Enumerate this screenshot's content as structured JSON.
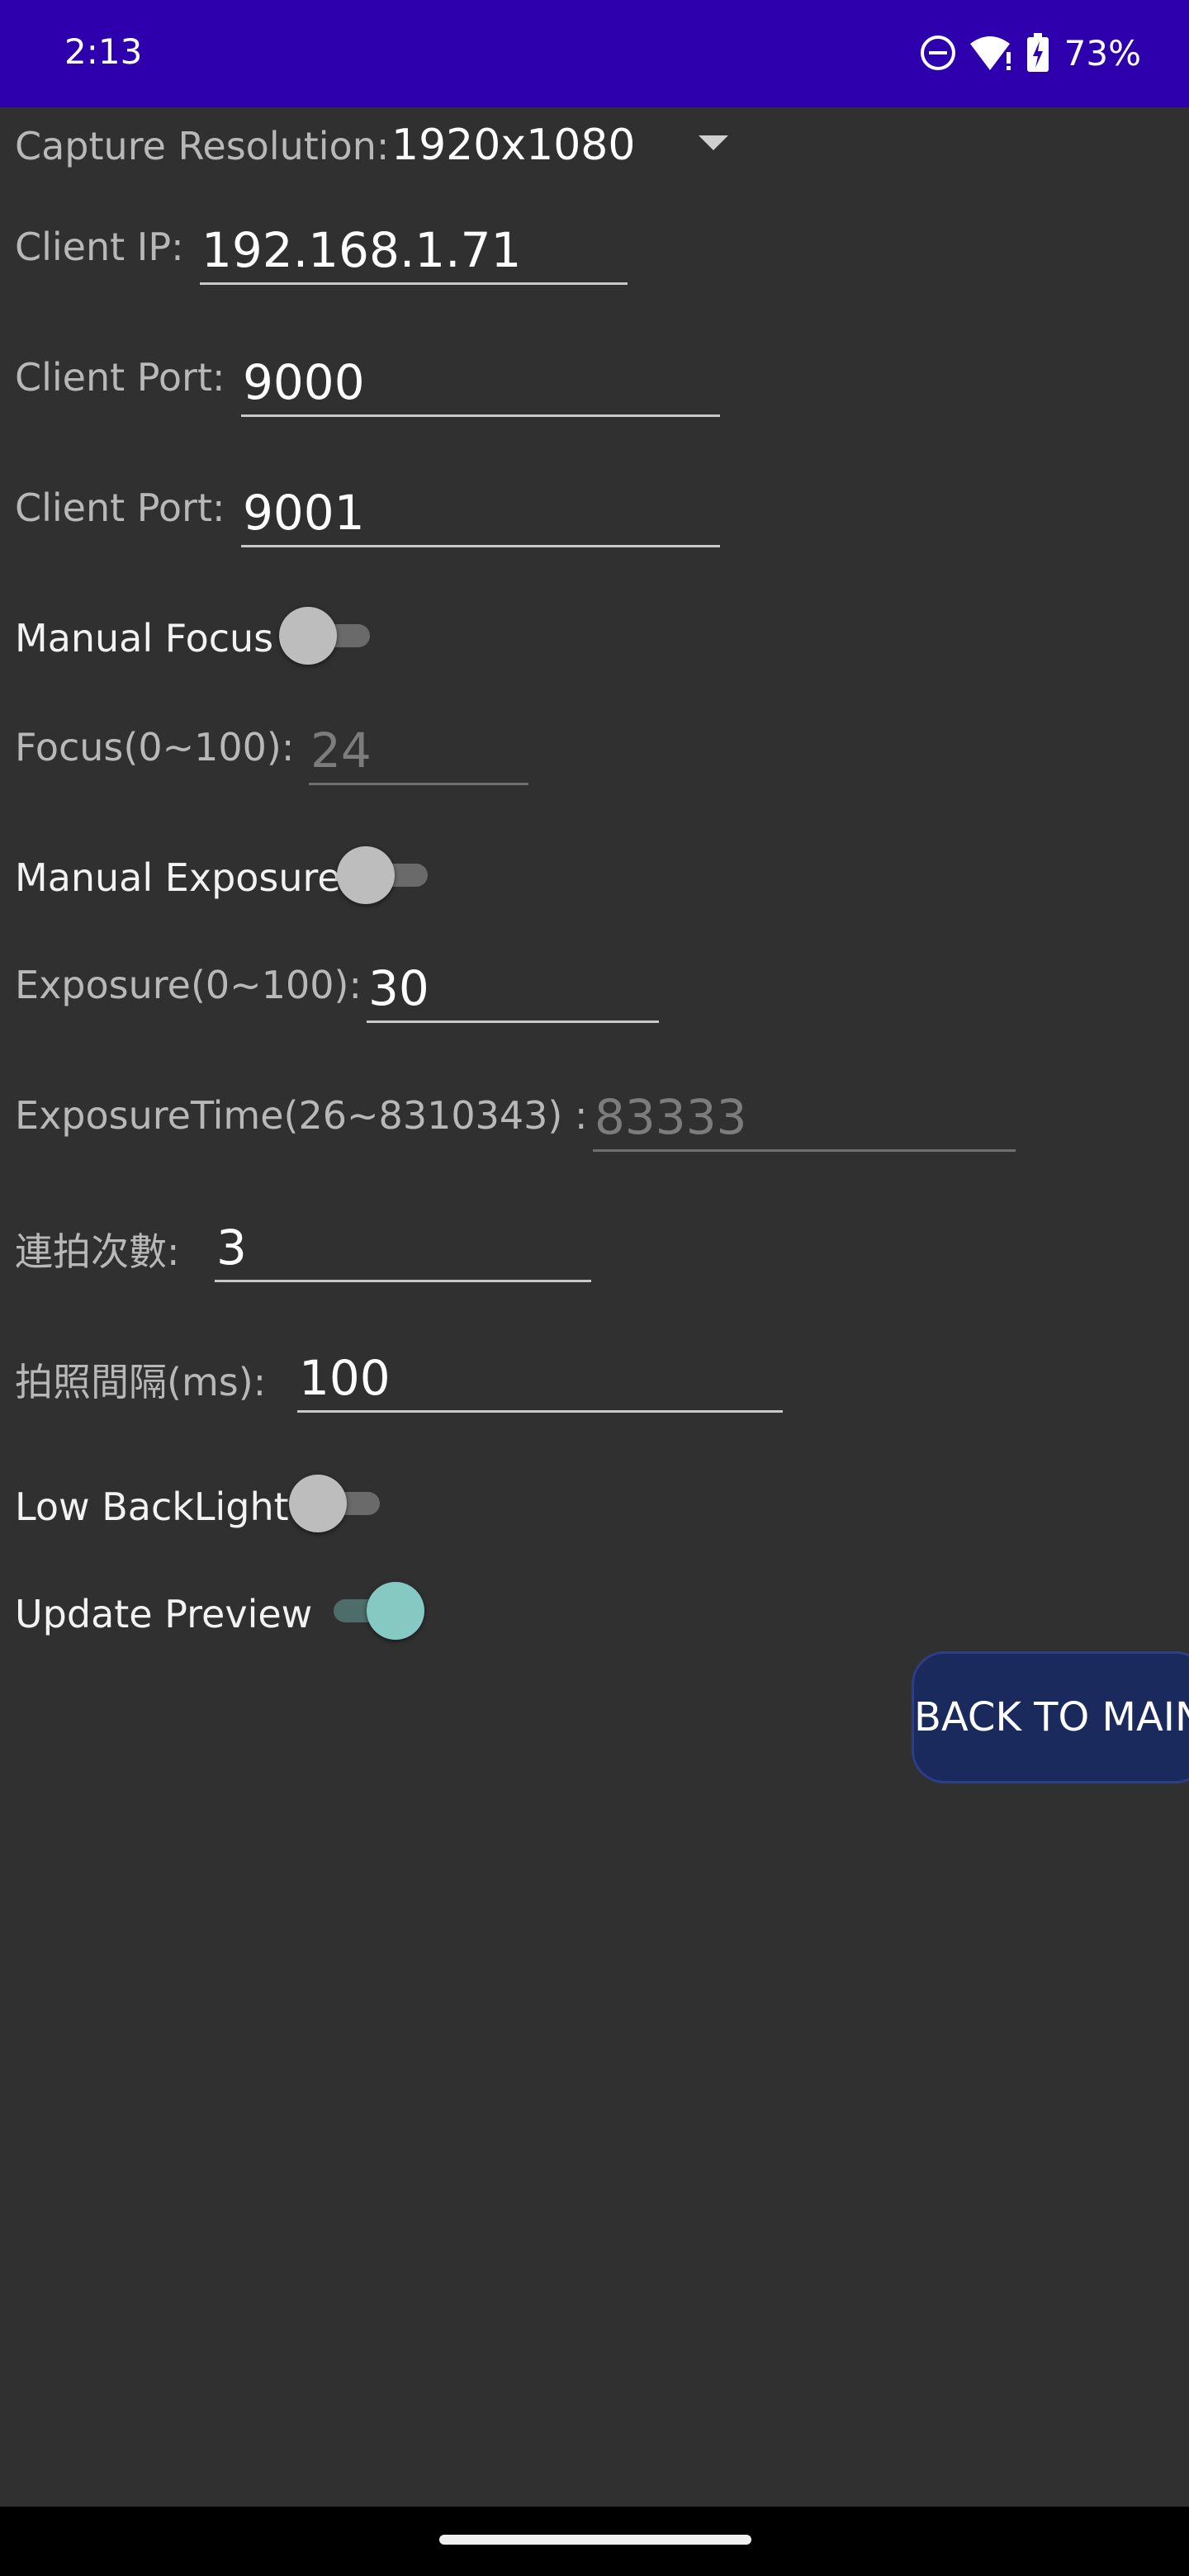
{
  "status_bar": {
    "time": "2:13",
    "battery_percent": "73%",
    "icons": [
      "do-not-disturb-icon",
      "wifi-icon",
      "battery-charging-icon"
    ],
    "background": "#2e00ad"
  },
  "form": {
    "capture_resolution": {
      "label": "Capture Resolution:",
      "value": "1920x1080"
    },
    "client_ip": {
      "label": "Client IP:",
      "value": "192.168.1.71"
    },
    "client_port_1": {
      "label": "Client Port:",
      "value": "9000"
    },
    "client_port_2": {
      "label": "Client Port:",
      "value": "9001"
    },
    "manual_focus": {
      "label": "Manual Focus",
      "checked": false
    },
    "focus": {
      "label": "Focus(0~100):",
      "value": "24",
      "enabled": false
    },
    "manual_exposure": {
      "label": "Manual Exposure",
      "checked": false
    },
    "exposure": {
      "label": "Exposure(0~100):",
      "value": "30"
    },
    "exposure_time": {
      "label": "ExposureTime(26~8310343) :",
      "value": "83333",
      "enabled": false
    },
    "burst_count": {
      "label": "連拍次數:",
      "value": "3"
    },
    "shot_interval": {
      "label": "拍照間隔(ms):",
      "value": "100"
    },
    "low_backlight": {
      "label": "Low BackLight",
      "checked": false
    },
    "update_preview": {
      "label": "Update Preview",
      "checked": true
    }
  },
  "back_button": {
    "label": "BACK TO MAIN"
  },
  "colors": {
    "background": "#303030",
    "accent_switch": "#86c9c3",
    "button": "#1b2a5c"
  }
}
